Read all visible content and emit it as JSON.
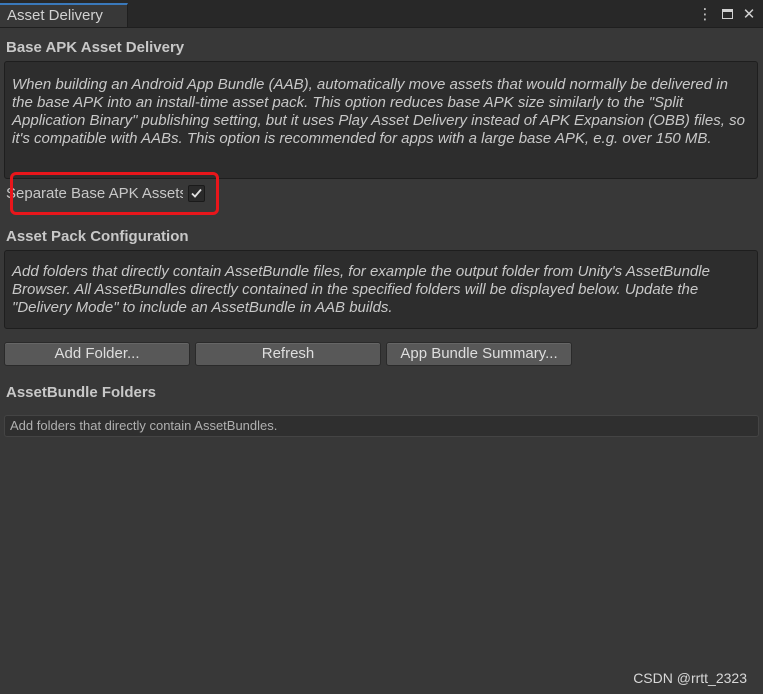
{
  "window": {
    "tab_title": "Asset Delivery",
    "menu_icon": "kebab-menu-icon",
    "maximize_icon": "maximize-icon",
    "close_icon": "close-icon"
  },
  "base_apk": {
    "title": "Base APK Asset Delivery",
    "help": "When building an Android App Bundle (AAB), automatically move assets that would normally be delivered in the base APK into an install-time asset pack. This option reduces base APK size similarly to the \"Split Application Binary\" publishing setting, but it uses Play Asset Delivery instead of APK Expansion (OBB) files, so it's compatible with AABs. This option is recommended for apps with a large base APK, e.g. over 150 MB.",
    "toggle_label": "Separate Base APK Assets",
    "toggle_checked": true
  },
  "asset_pack": {
    "title": "Asset Pack Configuration",
    "help": "Add folders that directly contain AssetBundle files, for example the output folder from Unity's AssetBundle Browser. All AssetBundles directly contained in the specified folders will be displayed below. Update the \"Delivery Mode\" to include an AssetBundle in AAB builds."
  },
  "buttons": {
    "add_folder": "Add Folder...",
    "refresh": "Refresh",
    "summary": "App Bundle Summary..."
  },
  "folders": {
    "title": "AssetBundle Folders",
    "empty_message": "Add folders that directly contain AssetBundles."
  },
  "watermark": "CSDN @rrtt_2323",
  "colors": {
    "background": "#383838",
    "highlight": "#e8161b",
    "tab_accent": "#3a79bb"
  }
}
